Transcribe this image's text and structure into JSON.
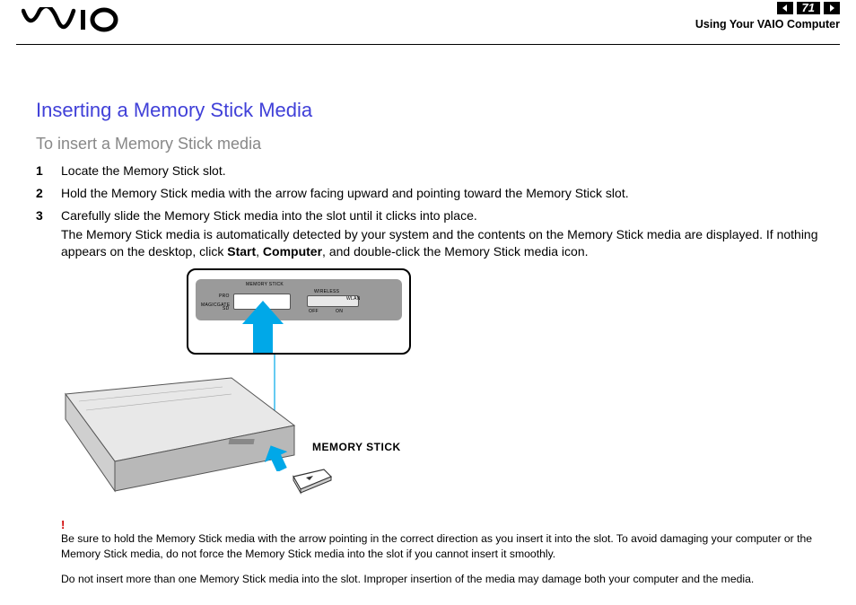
{
  "header": {
    "logo_text": "VAIO",
    "page_number": "71",
    "section": "Using Your VAIO Computer"
  },
  "title": "Inserting a Memory Stick Media",
  "subtitle": "To insert a Memory Stick media",
  "steps": [
    {
      "num": "1",
      "text": "Locate the Memory Stick slot."
    },
    {
      "num": "2",
      "text": "Hold the Memory Stick media with the arrow facing upward and pointing toward the Memory Stick slot."
    },
    {
      "num": "3",
      "text": "Carefully slide the Memory Stick media into the slot until it clicks into place."
    }
  ],
  "step3_extra_pre": "The Memory Stick media is automatically detected by your system and the contents on the Memory Stick media are displayed. If nothing appears on the desktop, click ",
  "step3_bold1": "Start",
  "step3_mid": ", ",
  "step3_bold2": "Computer",
  "step3_extra_post": ", and double-click the Memory Stick media icon.",
  "figure": {
    "panel_labels": {
      "memory_stick_top": "MEMORY STICK",
      "pro": "PRO",
      "magicgate": "MAGICGATE",
      "sd": "SD",
      "wireless": "WIRELESS",
      "wlan": "WLAN",
      "off": "OFF",
      "on": "ON"
    },
    "side_label": "MEMORY STICK"
  },
  "warning_mark": "!",
  "warning1": "Be sure to hold the Memory Stick media with the arrow pointing in the correct direction as you insert it into the slot. To avoid damaging your computer or the Memory Stick media, do not force the Memory Stick media into the slot if you cannot insert it smoothly.",
  "warning2": "Do not insert more than one Memory Stick media into the slot. Improper insertion of the media may damage both your computer and the media."
}
